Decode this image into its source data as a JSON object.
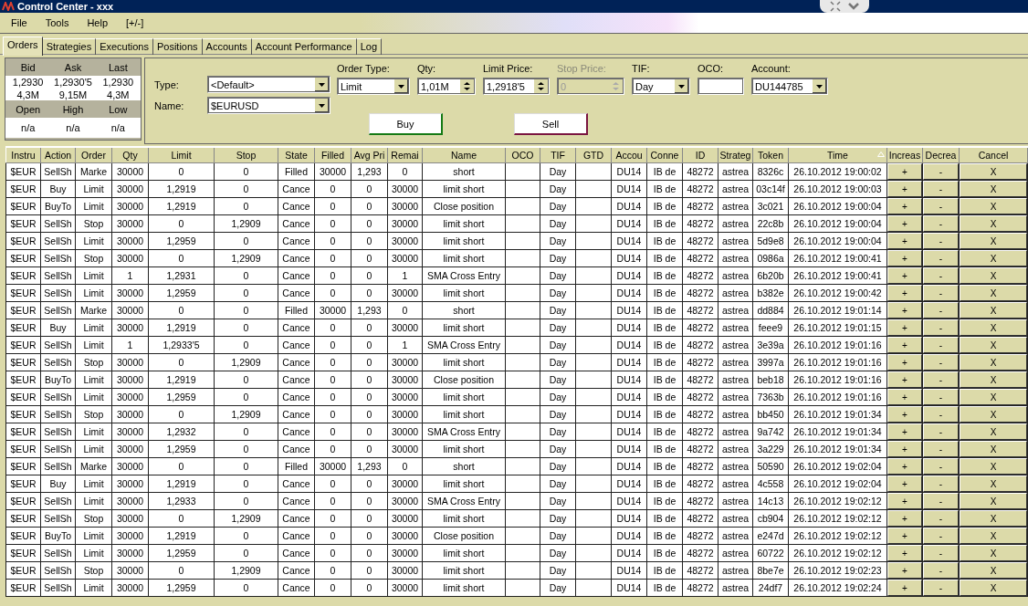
{
  "window": {
    "title": "Control Center - xxx"
  },
  "menu": [
    "File",
    "Tools",
    "Help",
    "[+/-]"
  ],
  "tabs": [
    {
      "label": "Orders",
      "selected": true
    },
    {
      "label": "Strategies",
      "selected": false
    },
    {
      "label": "Executions",
      "selected": false
    },
    {
      "label": "Positions",
      "selected": false
    },
    {
      "label": "Accounts",
      "selected": false
    },
    {
      "label": "Account Performance",
      "selected": false
    },
    {
      "label": "Log",
      "selected": false
    }
  ],
  "quote": {
    "top_headers": [
      "Bid",
      "Ask",
      "Last"
    ],
    "prices": [
      "1,2930",
      "1,2930'5",
      "1,2930"
    ],
    "sizes": [
      "4,3M",
      "9,15M",
      "4,3M"
    ],
    "bottom_headers": [
      "Open",
      "High",
      "Low"
    ],
    "bottom_values": [
      "n/a",
      "n/a",
      "n/a"
    ]
  },
  "order_form": {
    "type": {
      "label": "Type:",
      "value": "<Default>"
    },
    "name": {
      "label": "Name:",
      "value": "$EURUSD"
    },
    "fields": [
      {
        "kind": "combo",
        "label": "Order Type:",
        "value": "Limit",
        "disabled": false
      },
      {
        "kind": "spinner",
        "label": "Qty:",
        "value": "1,01M",
        "disabled": false
      },
      {
        "kind": "spinner",
        "label": "Limit Price:",
        "value": "1,2918'5",
        "disabled": false
      },
      {
        "kind": "spinner",
        "label": "Stop Price:",
        "value": "0",
        "disabled": true
      },
      {
        "kind": "combo",
        "label": "TIF:",
        "value": "Day",
        "disabled": false
      },
      {
        "kind": "text",
        "label": "OCO:",
        "disabled": false
      },
      {
        "kind": "combo",
        "label": "Account:",
        "value": "DU144785",
        "disabled": false
      }
    ],
    "buttons": [
      {
        "label": "Buy",
        "kind": "buy"
      },
      {
        "label": "Sell",
        "kind": "sell"
      }
    ]
  },
  "table": {
    "columns": [
      {
        "label": "Instru",
        "kind": "text",
        "sorted": false
      },
      {
        "label": "Action",
        "kind": "text",
        "sorted": false
      },
      {
        "label": "Order",
        "kind": "text",
        "sorted": false
      },
      {
        "label": "Qty",
        "kind": "text",
        "sorted": false
      },
      {
        "label": "Limit",
        "kind": "text",
        "sorted": false
      },
      {
        "label": "Stop",
        "kind": "text",
        "sorted": false
      },
      {
        "label": "State",
        "kind": "text",
        "sorted": false
      },
      {
        "label": "Filled",
        "kind": "text",
        "sorted": false
      },
      {
        "label": "Avg Pri",
        "kind": "text",
        "sorted": false
      },
      {
        "label": "Remai",
        "kind": "text",
        "sorted": false
      },
      {
        "label": "Name",
        "kind": "text",
        "sorted": false
      },
      {
        "label": "OCO",
        "kind": "text",
        "sorted": false
      },
      {
        "label": "TIF",
        "kind": "text",
        "sorted": false
      },
      {
        "label": "GTD",
        "kind": "text",
        "sorted": false
      },
      {
        "label": "Accou",
        "kind": "text",
        "sorted": false
      },
      {
        "label": "Conne",
        "kind": "text",
        "sorted": false
      },
      {
        "label": "ID",
        "kind": "text",
        "sorted": false
      },
      {
        "label": "Strateg",
        "kind": "text",
        "sorted": false
      },
      {
        "label": "Token",
        "kind": "text",
        "sorted": false
      },
      {
        "label": "Time",
        "kind": "text",
        "sorted": true
      },
      {
        "label": "Increas",
        "kind": "button",
        "sorted": false
      },
      {
        "label": "Decrea",
        "kind": "button",
        "sorted": false
      },
      {
        "label": "Cancel",
        "kind": "button",
        "sorted": false
      }
    ],
    "rows": [
      {
        "cells": [
          "$EUR",
          "SellSh",
          "Marke",
          "30000",
          "0",
          "0",
          "Filled",
          "30000",
          "1,293",
          "0",
          "short",
          "",
          "Day",
          "",
          "DU14",
          "IB de",
          "48272",
          "astrea",
          "8326c",
          "26.10.2012 19:00:02"
        ],
        "actions": [
          "+",
          "-",
          "X"
        ]
      },
      {
        "cells": [
          "$EUR",
          "Buy",
          "Limit",
          "30000",
          "1,2919",
          "0",
          "Cance",
          "0",
          "0",
          "30000",
          "limit short",
          "",
          "Day",
          "",
          "DU14",
          "IB de",
          "48272",
          "astrea",
          "03c14f",
          "26.10.2012 19:00:03"
        ],
        "actions": [
          "+",
          "-",
          "X"
        ]
      },
      {
        "cells": [
          "$EUR",
          "BuyTo",
          "Limit",
          "30000",
          "1,2919",
          "0",
          "Cance",
          "0",
          "0",
          "30000",
          "Close position",
          "",
          "Day",
          "",
          "DU14",
          "IB de",
          "48272",
          "astrea",
          "3c021",
          "26.10.2012 19:00:04"
        ],
        "actions": [
          "+",
          "-",
          "X"
        ]
      },
      {
        "cells": [
          "$EUR",
          "SellSh",
          "Stop",
          "30000",
          "0",
          "1,2909",
          "Cance",
          "0",
          "0",
          "30000",
          "limit short",
          "",
          "Day",
          "",
          "DU14",
          "IB de",
          "48272",
          "astrea",
          "22c8b",
          "26.10.2012 19:00:04"
        ],
        "actions": [
          "+",
          "-",
          "X"
        ]
      },
      {
        "cells": [
          "$EUR",
          "SellSh",
          "Limit",
          "30000",
          "1,2959",
          "0",
          "Cance",
          "0",
          "0",
          "30000",
          "limit short",
          "",
          "Day",
          "",
          "DU14",
          "IB de",
          "48272",
          "astrea",
          "5d9e8",
          "26.10.2012 19:00:04"
        ],
        "actions": [
          "+",
          "-",
          "X"
        ]
      },
      {
        "cells": [
          "$EUR",
          "SellSh",
          "Stop",
          "30000",
          "0",
          "1,2909",
          "Cance",
          "0",
          "0",
          "30000",
          "limit short",
          "",
          "Day",
          "",
          "DU14",
          "IB de",
          "48272",
          "astrea",
          "0986a",
          "26.10.2012 19:00:41"
        ],
        "actions": [
          "+",
          "-",
          "X"
        ]
      },
      {
        "cells": [
          "$EUR",
          "SellSh",
          "Limit",
          "1",
          "1,2931",
          "0",
          "Cance",
          "0",
          "0",
          "1",
          "SMA Cross Entry",
          "",
          "Day",
          "",
          "DU14",
          "IB de",
          "48272",
          "astrea",
          "6b20b",
          "26.10.2012 19:00:41"
        ],
        "actions": [
          "+",
          "-",
          "X"
        ]
      },
      {
        "cells": [
          "$EUR",
          "SellSh",
          "Limit",
          "30000",
          "1,2959",
          "0",
          "Cance",
          "0",
          "0",
          "30000",
          "limit short",
          "",
          "Day",
          "",
          "DU14",
          "IB de",
          "48272",
          "astrea",
          "b382e",
          "26.10.2012 19:00:42"
        ],
        "actions": [
          "+",
          "-",
          "X"
        ]
      },
      {
        "cells": [
          "$EUR",
          "SellSh",
          "Marke",
          "30000",
          "0",
          "0",
          "Filled",
          "30000",
          "1,293",
          "0",
          "short",
          "",
          "Day",
          "",
          "DU14",
          "IB de",
          "48272",
          "astrea",
          "dd884",
          "26.10.2012 19:01:14"
        ],
        "actions": [
          "+",
          "-",
          "X"
        ]
      },
      {
        "cells": [
          "$EUR",
          "Buy",
          "Limit",
          "30000",
          "1,2919",
          "0",
          "Cance",
          "0",
          "0",
          "30000",
          "limit short",
          "",
          "Day",
          "",
          "DU14",
          "IB de",
          "48272",
          "astrea",
          "feee9",
          "26.10.2012 19:01:15"
        ],
        "actions": [
          "+",
          "-",
          "X"
        ]
      },
      {
        "cells": [
          "$EUR",
          "SellSh",
          "Limit",
          "1",
          "1,2933'5",
          "0",
          "Cance",
          "0",
          "0",
          "1",
          "SMA Cross Entry",
          "",
          "Day",
          "",
          "DU14",
          "IB de",
          "48272",
          "astrea",
          "3e39a",
          "26.10.2012 19:01:16"
        ],
        "actions": [
          "+",
          "-",
          "X"
        ]
      },
      {
        "cells": [
          "$EUR",
          "SellSh",
          "Stop",
          "30000",
          "0",
          "1,2909",
          "Cance",
          "0",
          "0",
          "30000",
          "limit short",
          "",
          "Day",
          "",
          "DU14",
          "IB de",
          "48272",
          "astrea",
          "3997a",
          "26.10.2012 19:01:16"
        ],
        "actions": [
          "+",
          "-",
          "X"
        ]
      },
      {
        "cells": [
          "$EUR",
          "BuyTo",
          "Limit",
          "30000",
          "1,2919",
          "0",
          "Cance",
          "0",
          "0",
          "30000",
          "Close position",
          "",
          "Day",
          "",
          "DU14",
          "IB de",
          "48272",
          "astrea",
          "beb18",
          "26.10.2012 19:01:16"
        ],
        "actions": [
          "+",
          "-",
          "X"
        ]
      },
      {
        "cells": [
          "$EUR",
          "SellSh",
          "Limit",
          "30000",
          "1,2959",
          "0",
          "Cance",
          "0",
          "0",
          "30000",
          "limit short",
          "",
          "Day",
          "",
          "DU14",
          "IB de",
          "48272",
          "astrea",
          "7363b",
          "26.10.2012 19:01:16"
        ],
        "actions": [
          "+",
          "-",
          "X"
        ]
      },
      {
        "cells": [
          "$EUR",
          "SellSh",
          "Stop",
          "30000",
          "0",
          "1,2909",
          "Cance",
          "0",
          "0",
          "30000",
          "limit short",
          "",
          "Day",
          "",
          "DU14",
          "IB de",
          "48272",
          "astrea",
          "bb450",
          "26.10.2012 19:01:34"
        ],
        "actions": [
          "+",
          "-",
          "X"
        ]
      },
      {
        "cells": [
          "$EUR",
          "SellSh",
          "Limit",
          "30000",
          "1,2932",
          "0",
          "Cance",
          "0",
          "0",
          "30000",
          "SMA Cross Entry",
          "",
          "Day",
          "",
          "DU14",
          "IB de",
          "48272",
          "astrea",
          "9a742",
          "26.10.2012 19:01:34"
        ],
        "actions": [
          "+",
          "-",
          "X"
        ]
      },
      {
        "cells": [
          "$EUR",
          "SellSh",
          "Limit",
          "30000",
          "1,2959",
          "0",
          "Cance",
          "0",
          "0",
          "30000",
          "limit short",
          "",
          "Day",
          "",
          "DU14",
          "IB de",
          "48272",
          "astrea",
          "3a229",
          "26.10.2012 19:01:34"
        ],
        "actions": [
          "+",
          "-",
          "X"
        ]
      },
      {
        "cells": [
          "$EUR",
          "SellSh",
          "Marke",
          "30000",
          "0",
          "0",
          "Filled",
          "30000",
          "1,293",
          "0",
          "short",
          "",
          "Day",
          "",
          "DU14",
          "IB de",
          "48272",
          "astrea",
          "50590",
          "26.10.2012 19:02:04"
        ],
        "actions": [
          "+",
          "-",
          "X"
        ]
      },
      {
        "cells": [
          "$EUR",
          "Buy",
          "Limit",
          "30000",
          "1,2919",
          "0",
          "Cance",
          "0",
          "0",
          "30000",
          "limit short",
          "",
          "Day",
          "",
          "DU14",
          "IB de",
          "48272",
          "astrea",
          "4c558",
          "26.10.2012 19:02:04"
        ],
        "actions": [
          "+",
          "-",
          "X"
        ]
      },
      {
        "cells": [
          "$EUR",
          "SellSh",
          "Limit",
          "30000",
          "1,2933",
          "0",
          "Cance",
          "0",
          "0",
          "30000",
          "SMA Cross Entry",
          "",
          "Day",
          "",
          "DU14",
          "IB de",
          "48272",
          "astrea",
          "14c13",
          "26.10.2012 19:02:12"
        ],
        "actions": [
          "+",
          "-",
          "X"
        ]
      },
      {
        "cells": [
          "$EUR",
          "SellSh",
          "Stop",
          "30000",
          "0",
          "1,2909",
          "Cance",
          "0",
          "0",
          "30000",
          "limit short",
          "",
          "Day",
          "",
          "DU14",
          "IB de",
          "48272",
          "astrea",
          "cb904",
          "26.10.2012 19:02:12"
        ],
        "actions": [
          "+",
          "-",
          "X"
        ]
      },
      {
        "cells": [
          "$EUR",
          "BuyTo",
          "Limit",
          "30000",
          "1,2919",
          "0",
          "Cance",
          "0",
          "0",
          "30000",
          "Close position",
          "",
          "Day",
          "",
          "DU14",
          "IB de",
          "48272",
          "astrea",
          "e247d",
          "26.10.2012 19:02:12"
        ],
        "actions": [
          "+",
          "-",
          "X"
        ]
      },
      {
        "cells": [
          "$EUR",
          "SellSh",
          "Limit",
          "30000",
          "1,2959",
          "0",
          "Cance",
          "0",
          "0",
          "30000",
          "limit short",
          "",
          "Day",
          "",
          "DU14",
          "IB de",
          "48272",
          "astrea",
          "60722",
          "26.10.2012 19:02:12"
        ],
        "actions": [
          "+",
          "-",
          "X"
        ]
      },
      {
        "cells": [
          "$EUR",
          "SellSh",
          "Stop",
          "30000",
          "0",
          "1,2909",
          "Cance",
          "0",
          "0",
          "30000",
          "limit short",
          "",
          "Day",
          "",
          "DU14",
          "IB de",
          "48272",
          "astrea",
          "8be7e",
          "26.10.2012 19:02:23"
        ],
        "actions": [
          "+",
          "-",
          "X"
        ]
      },
      {
        "cells": [
          "$EUR",
          "SellSh",
          "Limit",
          "30000",
          "1,2959",
          "0",
          "Cance",
          "0",
          "0",
          "30000",
          "limit short",
          "",
          "Day",
          "",
          "DU14",
          "IB de",
          "48272",
          "astrea",
          "24df7",
          "26.10.2012 19:02:24"
        ],
        "actions": [
          "+",
          "-",
          "X"
        ]
      }
    ]
  }
}
